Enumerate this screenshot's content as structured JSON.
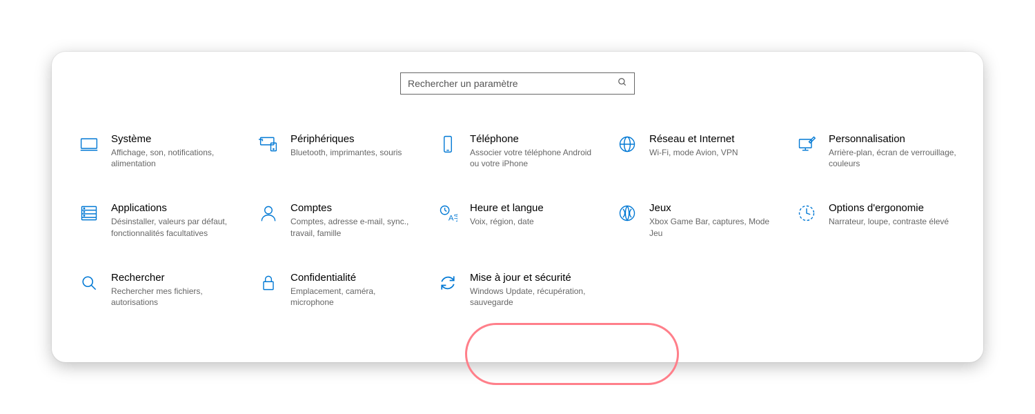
{
  "search": {
    "placeholder": "Rechercher un paramètre"
  },
  "tiles": [
    {
      "id": "system",
      "title": "Système",
      "desc": "Affichage, son, notifications, alimentation"
    },
    {
      "id": "devices",
      "title": "Périphériques",
      "desc": "Bluetooth, imprimantes, souris"
    },
    {
      "id": "phone",
      "title": "Téléphone",
      "desc": "Associer votre téléphone Android ou votre iPhone"
    },
    {
      "id": "network",
      "title": "Réseau et Internet",
      "desc": "Wi-Fi, mode Avion, VPN"
    },
    {
      "id": "personalize",
      "title": "Personnalisation",
      "desc": "Arrière-plan, écran de verrouillage, couleurs"
    },
    {
      "id": "apps",
      "title": "Applications",
      "desc": "Désinstaller, valeurs par défaut, fonctionnalités facultatives"
    },
    {
      "id": "accounts",
      "title": "Comptes",
      "desc": "Comptes, adresse e-mail, sync., travail, famille"
    },
    {
      "id": "time",
      "title": "Heure et langue",
      "desc": "Voix, région, date"
    },
    {
      "id": "gaming",
      "title": "Jeux",
      "desc": "Xbox Game Bar, captures, Mode Jeu"
    },
    {
      "id": "ease",
      "title": "Options d'ergonomie",
      "desc": "Narrateur, loupe, contraste élevé"
    },
    {
      "id": "search-cat",
      "title": "Rechercher",
      "desc": "Rechercher mes fichiers, autorisations"
    },
    {
      "id": "privacy",
      "title": "Confidentialité",
      "desc": "Emplacement, caméra, microphone"
    },
    {
      "id": "update",
      "title": "Mise à jour et sécurité",
      "desc": "Windows Update, récupération, sauvegarde"
    }
  ],
  "highlighted_tile": "update",
  "colors": {
    "accent": "#0078D4",
    "highlight_ring": "#ff7f8a"
  }
}
